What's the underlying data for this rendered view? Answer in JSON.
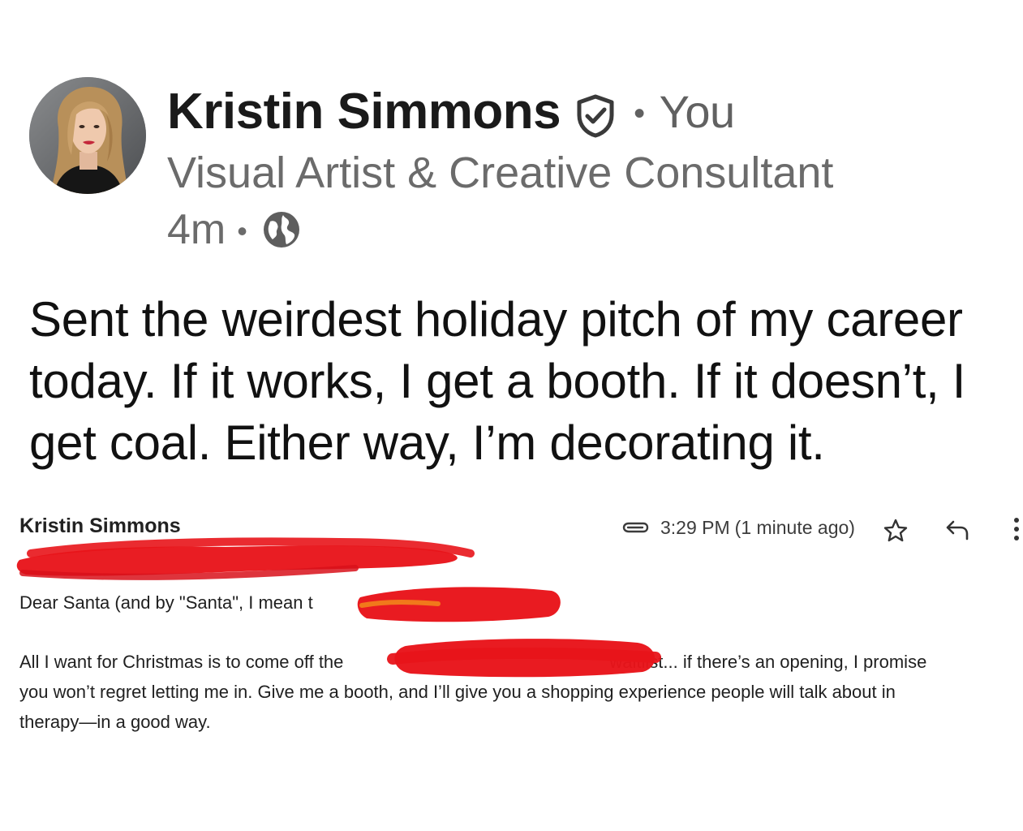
{
  "post": {
    "author": {
      "name": "Kristin Simmons",
      "connection": "You",
      "headline": "Visual Artist & Creative Consultant",
      "verified_icon": "shield-check-icon"
    },
    "meta": {
      "time_ago": "4m",
      "visibility_icon": "globe-icon"
    },
    "text": "Sent the weirdest holiday pitch of my career today. If it works, I get a booth. If it doesn’t, I get coal. Either way, I’m decorating it."
  },
  "email": {
    "from": "Kristin Simmons",
    "time": "3:29 PM",
    "time_ago": "(1 minute ago)",
    "icons": [
      "paperclip-icon",
      "star-icon",
      "reply-icon",
      "more-vert-icon"
    ],
    "greeting": "Dear Santa (and by \"Santa\", I mean t",
    "body_line_1_start": "All I want for Christmas is to come off the",
    "body_line_1_end": "waitlist... if there’s an opening, I promise",
    "body_line_2": "you won’t regret letting me in. Give me a booth, and I’ll give you a shopping experience people will talk about in",
    "body_line_3": "therapy—in a good way."
  },
  "colors": {
    "redaction": "#e8141a",
    "secondary_text": "#6b6b6b"
  }
}
